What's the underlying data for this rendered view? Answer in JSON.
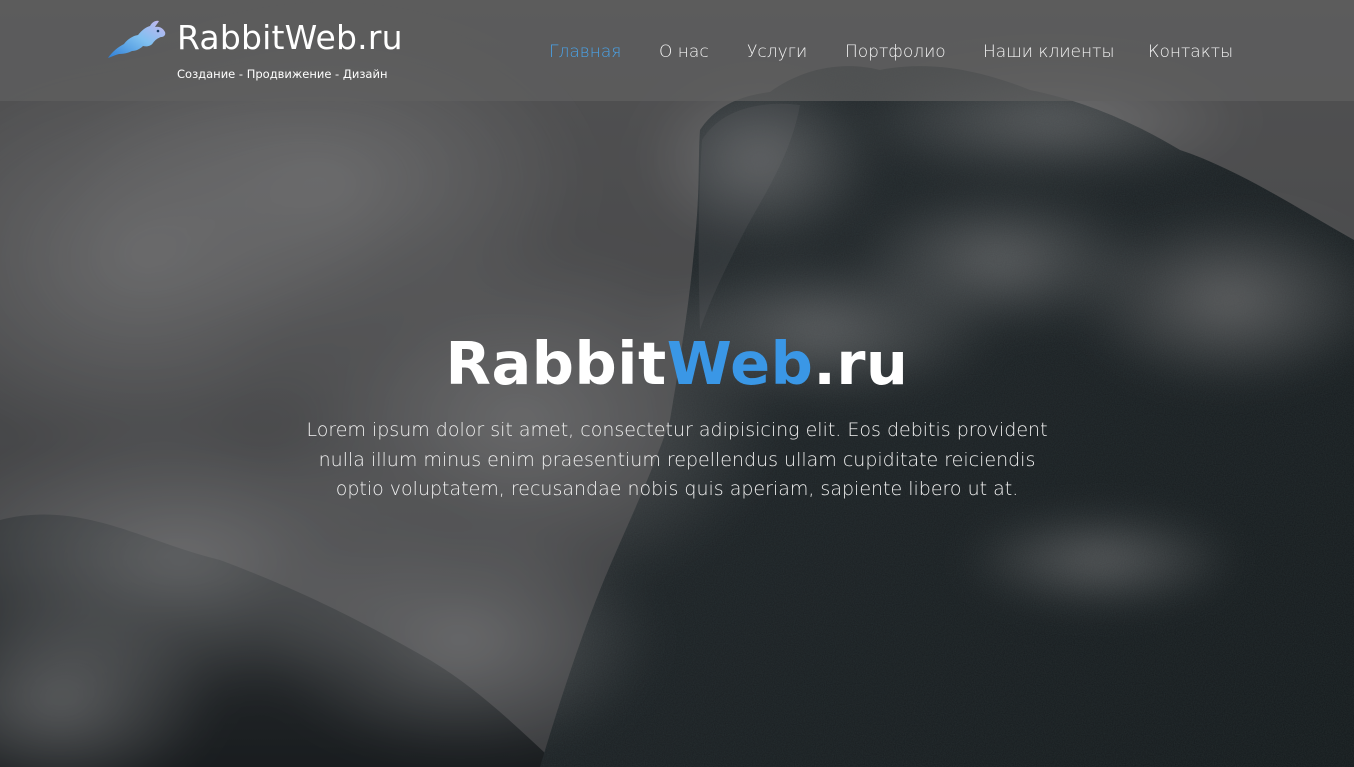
{
  "header": {
    "logo": {
      "icon": "rabbit-logo-icon",
      "name": "RabbitWeb.ru",
      "tagline": "Создание - Продвижение - Дизайн"
    },
    "nav": [
      {
        "label": "Главная",
        "active": true
      },
      {
        "label": "О нас",
        "active": false
      },
      {
        "label": "Услуги",
        "active": false
      },
      {
        "label": "Портфолио",
        "active": false
      },
      {
        "label": "Наши клиенты",
        "active": false
      },
      {
        "label": "Контакты",
        "active": false
      }
    ]
  },
  "hero": {
    "title_part1": "Rabbit",
    "title_part2": "Web",
    "title_part3": ".ru",
    "text": "Lorem ipsum dolor sit amet, consectetur adipisicing elit. Eos debitis provident nulla illum minus enim praesentium repellendus ullam cupiditate reiciendis optio voluptatem, recusandae nobis quis aperiam, sapiente libero ut at."
  },
  "colors": {
    "accent": "#3a97e6",
    "nav_active": "#4aa3e8",
    "header_bg": "rgba(95,95,95,0.72)",
    "text": "#ffffff"
  }
}
